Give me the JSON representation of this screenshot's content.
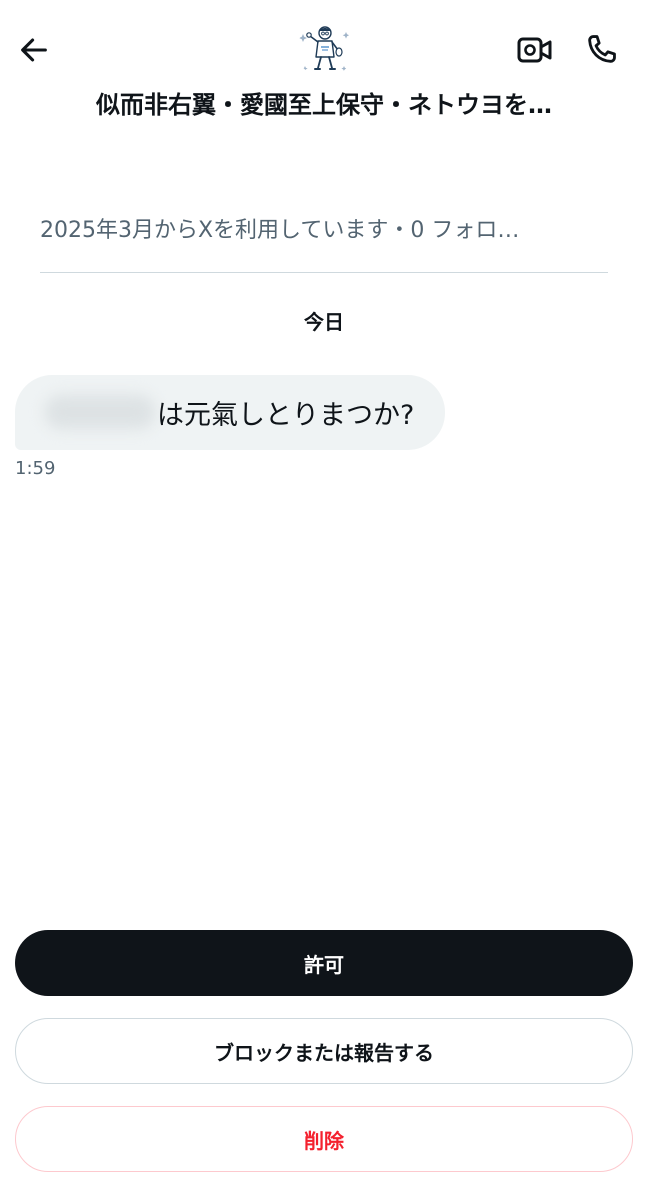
{
  "header": {
    "back_icon": "arrow-left-icon",
    "avatar_icon": "cartoon-person-avatar",
    "video_icon": "video-camera-icon",
    "call_icon": "phone-icon",
    "display_name": "似而非右翼・愛國至上保守・ネトウヨを…"
  },
  "profile": {
    "info": "2025年3月からXを利用しています・0 フォロ…"
  },
  "conversation": {
    "date_label": "今日",
    "messages": [
      {
        "text": "は元氣しとりまつか?",
        "time": "1:59"
      }
    ]
  },
  "actions": {
    "allow_label": "許可",
    "block_report_label": "ブロックまたは報告する",
    "delete_label": "削除"
  },
  "colors": {
    "text": "#0f1419",
    "secondary": "#536471",
    "bubble": "#eff3f4",
    "danger": "#f4212e",
    "border": "#cfd9de"
  }
}
